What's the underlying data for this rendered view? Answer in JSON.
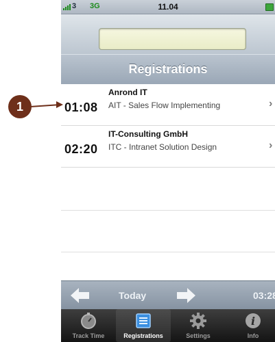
{
  "status_bar": {
    "carrier": "3",
    "network": "3G",
    "time": "11.04",
    "icons": [
      "signal-bars-icon",
      "battery-icon"
    ]
  },
  "header": {
    "field_value": "",
    "title": "Registrations"
  },
  "registrations": [
    {
      "duration": "01:08",
      "company": "Anrond IT",
      "task": "AIT - Sales Flow Implementing"
    },
    {
      "duration": "02:20",
      "company": "IT-Consulting GmbH",
      "task": "ITC - Intranet Solution Design"
    }
  ],
  "date_nav": {
    "label": "Today",
    "total": "03:28",
    "icons": [
      "arrow-left-icon",
      "arrow-right-icon"
    ]
  },
  "tabs": [
    {
      "label": "Track Time",
      "icon": "stopwatch-icon",
      "active": false
    },
    {
      "label": "Registrations",
      "icon": "list-tray-icon",
      "active": true
    },
    {
      "label": "Settings",
      "icon": "gear-icon",
      "active": false
    },
    {
      "label": "Info",
      "icon": "info-icon",
      "active": false
    }
  ],
  "callout": {
    "number": "1"
  },
  "colors": {
    "callout": "#6e2f1a",
    "tabbar": "#1f1f1f",
    "titlebar": "#a5b1be",
    "signal": "#1a8a1a"
  }
}
